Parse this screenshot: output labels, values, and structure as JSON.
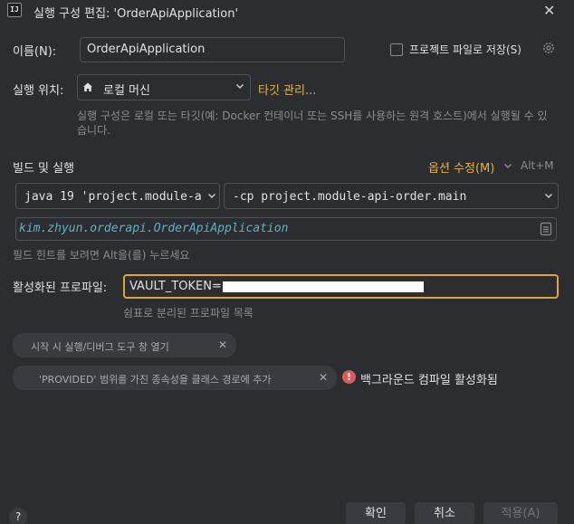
{
  "dialog": {
    "title": "실행 구성 편집: 'OrderApiApplication'",
    "icon_text": "IJ"
  },
  "name": {
    "label": "이름(N):",
    "value": "OrderApiApplication",
    "store_as_project_file_label": "프로젝트 파일로 저장(S)",
    "store_as_project_file_checked": false
  },
  "run_on": {
    "label": "실행 위치:",
    "value": "로컬 머신",
    "manage_targets_link": "타깃 관리...",
    "description": "실행 구성은 로컬 또는 타깃(예: Docker 컨테이너 또는 SSH를 사용하는 원격 호스트)에서 실행될 수 있습니다."
  },
  "build_and_run": {
    "section_label": "빌드 및 실행",
    "modify_options_label": "옵션 수정(M)",
    "modify_options_shortcut": "Alt+M",
    "jre_value": "java 19 'project.module-ap",
    "classpath_value": "-cp project.module-api-order.main",
    "main_class_value": "kim.zhyun.orderapi.OrderApiApplication",
    "field_hint": "필드 힌트를 보려면 Alt을(를) 누르세요"
  },
  "profiles": {
    "label": "활성화된 프로파일:",
    "value": "VAULT_TOKEN=",
    "hint": "쉼표로 분리된 프로파일 목록"
  },
  "options": {
    "open_tool_window": "시작 시 실행/디버그 도구 창 열기",
    "add_provided_scope": "'PROVIDED' 범위를 가진 종속성을 클래스 경로에 추가",
    "background_compile_warning": "백그라운드 컴파일 활성화됨"
  },
  "footer": {
    "ok": "확인",
    "cancel": "취소",
    "apply": "적용(A)",
    "help": "?"
  },
  "colors": {
    "background": "#2b2d30",
    "accent_link": "#e3b341",
    "error_red": "#db5c5c",
    "focus_border": "#e0a436"
  }
}
